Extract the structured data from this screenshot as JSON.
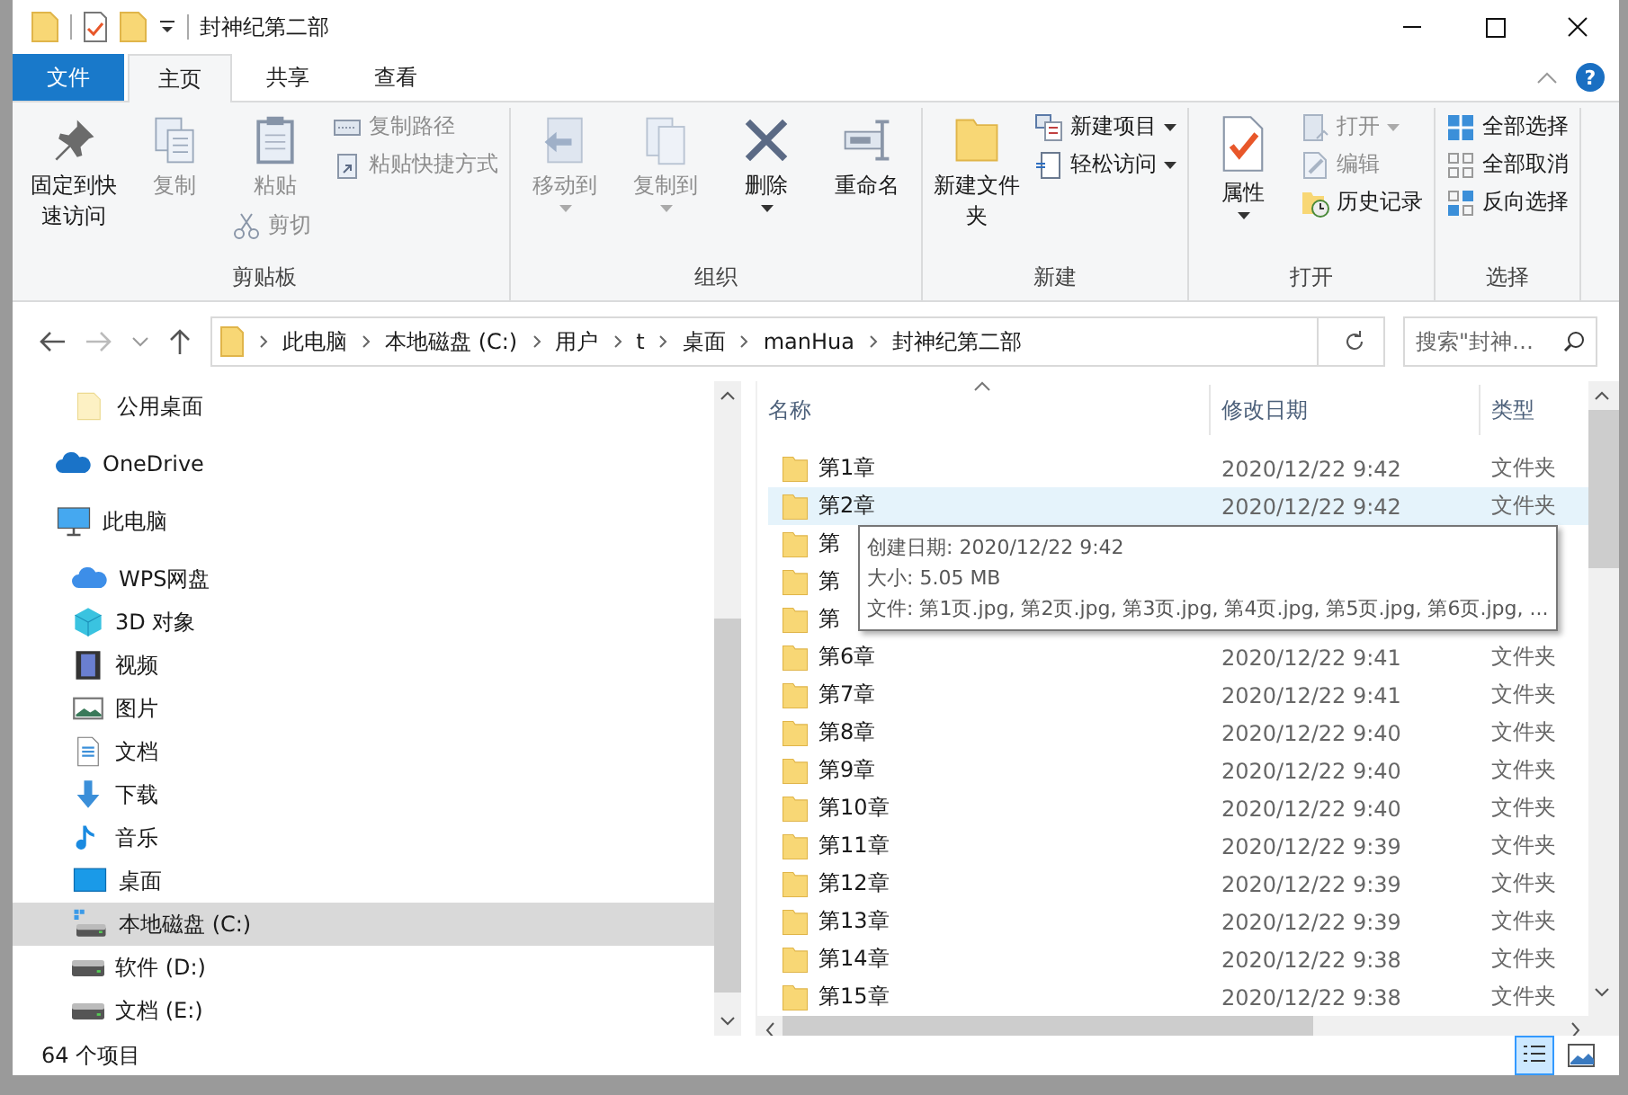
{
  "window": {
    "title": "封神纪第二部"
  },
  "tabs": [
    {
      "label": "文件",
      "kind": "file",
      "selected": false
    },
    {
      "label": "主页",
      "kind": "normal",
      "selected": true
    },
    {
      "label": "共享",
      "kind": "normal",
      "selected": false
    },
    {
      "label": "查看",
      "kind": "normal",
      "selected": false
    }
  ],
  "help": "?",
  "ribbon": {
    "groups": [
      {
        "label": "剪贴板",
        "columns": [
          [
            {
              "kind": "large",
              "label": "固定到快速访问",
              "disabled": false,
              "dropdown": false
            }
          ],
          [
            {
              "kind": "large",
              "label": "复制",
              "disabled": true,
              "dropdown": false
            }
          ],
          [
            {
              "kind": "large",
              "label": "粘贴",
              "disabled": true,
              "dropdown": false
            },
            {
              "kind": "small",
              "label": "剪切",
              "disabled": true,
              "dropdown": false
            }
          ],
          [
            {
              "kind": "small",
              "label": "复制路径",
              "disabled": true,
              "dropdown": false
            },
            {
              "kind": "small",
              "label": "粘贴快捷方式",
              "disabled": true,
              "dropdown": false
            }
          ]
        ]
      },
      {
        "label": "组织",
        "columns": [
          [
            {
              "kind": "large",
              "label": "移动到",
              "disabled": true,
              "dropdown": true
            }
          ],
          [
            {
              "kind": "large",
              "label": "复制到",
              "disabled": true,
              "dropdown": true
            }
          ],
          [
            {
              "kind": "large",
              "label": "删除",
              "disabled": false,
              "dropdown": true
            }
          ],
          [
            {
              "kind": "large",
              "label": "重命名",
              "disabled": false,
              "dropdown": false
            }
          ]
        ]
      },
      {
        "label": "新建",
        "columns": [
          [
            {
              "kind": "large",
              "label": "新建文件夹",
              "disabled": false,
              "dropdown": false
            }
          ],
          [
            {
              "kind": "small",
              "label": "新建项目",
              "disabled": false,
              "dropdown": true
            },
            {
              "kind": "small",
              "label": "轻松访问",
              "disabled": false,
              "dropdown": true
            }
          ]
        ]
      },
      {
        "label": "打开",
        "columns": [
          [
            {
              "kind": "large",
              "label": "属性",
              "disabled": false,
              "dropdown": true
            }
          ],
          [
            {
              "kind": "small",
              "label": "打开",
              "disabled": true,
              "dropdown": true
            },
            {
              "kind": "small",
              "label": "编辑",
              "disabled": true,
              "dropdown": false
            },
            {
              "kind": "small",
              "label": "历史记录",
              "disabled": false,
              "dropdown": false
            }
          ]
        ]
      },
      {
        "label": "选择",
        "columns": [
          [
            {
              "kind": "small",
              "label": "全部选择",
              "disabled": false,
              "dropdown": false
            },
            {
              "kind": "small",
              "label": "全部取消",
              "disabled": false,
              "dropdown": false
            },
            {
              "kind": "small",
              "label": "反向选择",
              "disabled": false,
              "dropdown": false
            }
          ]
        ]
      }
    ]
  },
  "address": {
    "crumbs": [
      "此电脑",
      "本地磁盘 (C:)",
      "用户",
      "t",
      "桌面",
      "manHua",
      "封神纪第二部"
    ],
    "search_placeholder": "搜索\"封神…"
  },
  "sidebar": {
    "items": [
      {
        "label": "公用桌面",
        "kind": "folder",
        "selected": false
      },
      {
        "label": "OneDrive",
        "kind": "cloud",
        "selected": false
      },
      {
        "label": "此电脑",
        "kind": "pc",
        "selected": false,
        "children": [
          {
            "label": "WPS网盘",
            "kind": "wps",
            "selected": false
          },
          {
            "label": "3D 对象",
            "kind": "cube",
            "selected": false
          },
          {
            "label": "视频",
            "kind": "video",
            "selected": false
          },
          {
            "label": "图片",
            "kind": "pictures",
            "selected": false
          },
          {
            "label": "文档",
            "kind": "documents",
            "selected": false
          },
          {
            "label": "下载",
            "kind": "downloads",
            "selected": false
          },
          {
            "label": "音乐",
            "kind": "music",
            "selected": false
          },
          {
            "label": "桌面",
            "kind": "desktop",
            "selected": false
          },
          {
            "label": "本地磁盘 (C:)",
            "kind": "systemdrive",
            "selected": true
          },
          {
            "label": "软件 (D:)",
            "kind": "drive",
            "selected": false
          },
          {
            "label": "文档 (E:)",
            "kind": "drive",
            "selected": false
          }
        ]
      }
    ]
  },
  "files": {
    "columns": [
      "名称",
      "修改日期",
      "类型"
    ],
    "rows": [
      {
        "name": "第1章",
        "modified": "2020/12/22 9:42",
        "type": "文件夹",
        "hovered": false
      },
      {
        "name": "第2章",
        "modified": "2020/12/22 9:42",
        "type": "文件夹",
        "hovered": true
      },
      {
        "name": "第",
        "hovered": false
      },
      {
        "name": "第",
        "hovered": false
      },
      {
        "name": "第",
        "hovered": false
      },
      {
        "name": "第6章",
        "modified": "2020/12/22 9:41",
        "type": "文件夹",
        "hovered": false
      },
      {
        "name": "第7章",
        "modified": "2020/12/22 9:41",
        "type": "文件夹",
        "hovered": false
      },
      {
        "name": "第8章",
        "modified": "2020/12/22 9:40",
        "type": "文件夹",
        "hovered": false
      },
      {
        "name": "第9章",
        "modified": "2020/12/22 9:40",
        "type": "文件夹",
        "hovered": false
      },
      {
        "name": "第10章",
        "modified": "2020/12/22 9:40",
        "type": "文件夹",
        "hovered": false
      },
      {
        "name": "第11章",
        "modified": "2020/12/22 9:39",
        "type": "文件夹",
        "hovered": false
      },
      {
        "name": "第12章",
        "modified": "2020/12/22 9:39",
        "type": "文件夹",
        "hovered": false
      },
      {
        "name": "第13章",
        "modified": "2020/12/22 9:39",
        "type": "文件夹",
        "hovered": false
      },
      {
        "name": "第14章",
        "modified": "2020/12/22 9:38",
        "type": "文件夹",
        "hovered": false
      },
      {
        "name": "第15章",
        "modified": "2020/12/22 9:38",
        "type": "文件夹",
        "hovered": false
      }
    ]
  },
  "tooltip": {
    "lines": [
      "创建日期: 2020/12/22 9:42",
      "大小: 5.05 MB",
      "文件: 第1页.jpg, 第2页.jpg, 第3页.jpg, 第4页.jpg, 第5页.jpg, 第6页.jpg, ..."
    ]
  },
  "status_bar": {
    "count": "64 个项目",
    "views": [
      {
        "kind": "details",
        "selected": true
      },
      {
        "kind": "largeicons",
        "selected": false
      }
    ]
  }
}
